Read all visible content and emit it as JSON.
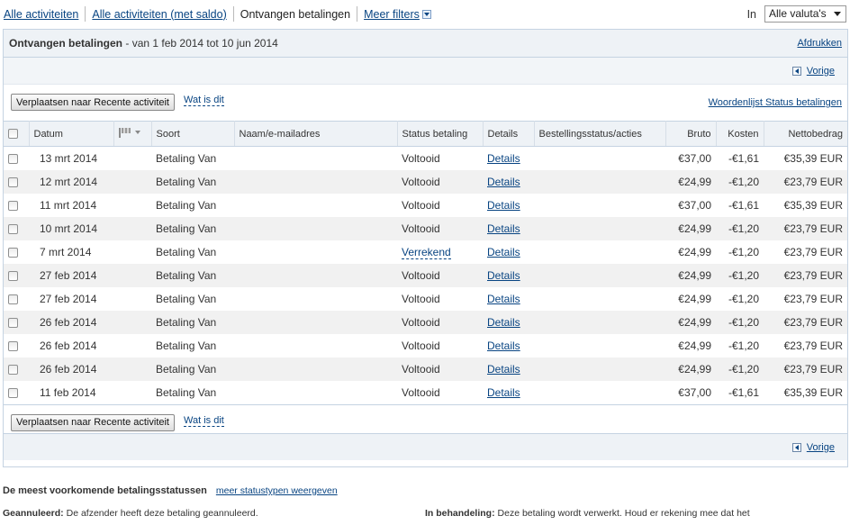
{
  "tabs": {
    "all": "Alle activiteiten",
    "all_balance": "Alle activiteiten (met saldo)",
    "received": "Ontvangen betalingen",
    "more_filters": "Meer filters"
  },
  "currency": {
    "label": "In",
    "value": "Alle valuta's"
  },
  "panel": {
    "title": "Ontvangen betalingen",
    "range": "- van 1 feb 2014 tot 10 jun 2014",
    "print": "Afdrukken",
    "prev": "Vorige"
  },
  "actions": {
    "move": "Verplaatsen naar Recente activiteit",
    "what": "Wat is dit",
    "glossary": "Woordenlijst Status betalingen"
  },
  "columns": {
    "date": "Datum",
    "type": "Soort",
    "name": "Naam/e-mailadres",
    "status": "Status betaling",
    "details": "Details",
    "order": "Bestellingsstatus/acties",
    "gross": "Bruto",
    "fee": "Kosten",
    "net": "Nettobedrag"
  },
  "rows": [
    {
      "date": "13 mrt 2014",
      "type": "Betaling Van",
      "name": "",
      "status": "Voltooid",
      "details": "Details",
      "gross": "€37,00",
      "fee": "-€1,61",
      "net": "€35,39 EUR"
    },
    {
      "date": "12 mrt 2014",
      "type": "Betaling Van",
      "name": "",
      "status": "Voltooid",
      "details": "Details",
      "gross": "€24,99",
      "fee": "-€1,20",
      "net": "€23,79 EUR"
    },
    {
      "date": "11 mrt 2014",
      "type": "Betaling Van",
      "name": "",
      "status": "Voltooid",
      "details": "Details",
      "gross": "€37,00",
      "fee": "-€1,61",
      "net": "€35,39 EUR"
    },
    {
      "date": "10 mrt 2014",
      "type": "Betaling Van",
      "name": "",
      "status": "Voltooid",
      "details": "Details",
      "gross": "€24,99",
      "fee": "-€1,20",
      "net": "€23,79 EUR"
    },
    {
      "date": "7 mrt 2014",
      "type": "Betaling Van",
      "name": "",
      "status": "Verrekend",
      "details": "Details",
      "gross": "€24,99",
      "fee": "-€1,20",
      "net": "€23,79 EUR"
    },
    {
      "date": "27 feb 2014",
      "type": "Betaling Van",
      "name": "",
      "status": "Voltooid",
      "details": "Details",
      "gross": "€24,99",
      "fee": "-€1,20",
      "net": "€23,79 EUR"
    },
    {
      "date": "27 feb 2014",
      "type": "Betaling Van",
      "name": "",
      "status": "Voltooid",
      "details": "Details",
      "gross": "€24,99",
      "fee": "-€1,20",
      "net": "€23,79 EUR"
    },
    {
      "date": "26 feb 2014",
      "type": "Betaling Van",
      "name": "",
      "status": "Voltooid",
      "details": "Details",
      "gross": "€24,99",
      "fee": "-€1,20",
      "net": "€23,79 EUR"
    },
    {
      "date": "26 feb 2014",
      "type": "Betaling Van",
      "name": "",
      "status": "Voltooid",
      "details": "Details",
      "gross": "€24,99",
      "fee": "-€1,20",
      "net": "€23,79 EUR"
    },
    {
      "date": "26 feb 2014",
      "type": "Betaling Van",
      "name": "",
      "status": "Voltooid",
      "details": "Details",
      "gross": "€24,99",
      "fee": "-€1,20",
      "net": "€23,79 EUR"
    },
    {
      "date": "11 feb 2014",
      "type": "Betaling Van",
      "name": "",
      "status": "Voltooid",
      "details": "Details",
      "gross": "€37,00",
      "fee": "-€1,61",
      "net": "€35,39 EUR"
    }
  ],
  "legend": {
    "title": "De meest voorkomende betalingsstatussen",
    "more": "meer statustypen weergeven",
    "cancelled_label": "Geannuleerd:",
    "cancelled_text": "De afzender heeft deze betaling geannuleerd.",
    "pending_label": "In behandeling:",
    "pending_text": "Deze betaling wordt verwerkt. Houd er rekening mee dat het"
  },
  "icons": {
    "flag_column": "flag-icon",
    "prev": "arrow-left-icon",
    "filters_toggle": "chevron-down-icon",
    "currency_select": "chevron-down-icon"
  },
  "colors": {
    "link": "#084482",
    "header_bg": "#eef2f6",
    "row_alt": "#f1f1f1"
  }
}
